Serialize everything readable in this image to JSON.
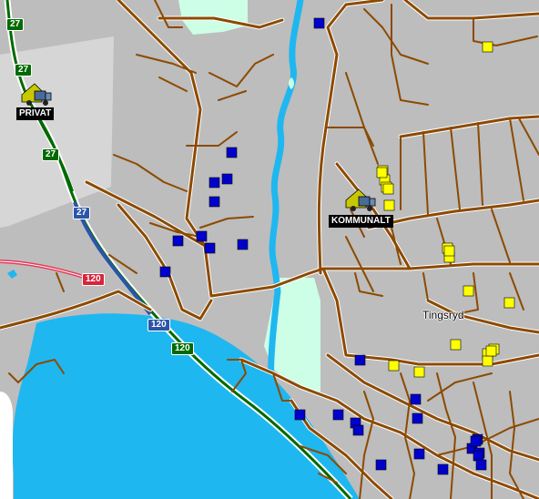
{
  "colors": {
    "background": "#bdbdbd",
    "urban_light": "#d4d4d4",
    "water": "#1fb7f0",
    "park": "#ccffe6",
    "road": "#8c4a00",
    "road_casing": "#ffffff",
    "highway": "#006a00",
    "highway_alt": "#2b55a8",
    "rail": "#e83a5a",
    "marker_blue": "#0000cc",
    "marker_yellow": "#ffff00"
  },
  "depots": [
    {
      "name": "privat-depot",
      "label": "PRIVAT"
    },
    {
      "name": "kommunalt-depot",
      "label": "KOMMUNALT"
    }
  ],
  "place_labels": [
    {
      "name": "tingsryd-label",
      "text": "Tingsryd"
    }
  ],
  "road_shields": [
    {
      "name": "shield-27",
      "text": "27",
      "color": "#006a00"
    },
    {
      "name": "shield-27",
      "text": "27",
      "color": "#006a00"
    },
    {
      "name": "shield-27",
      "text": "27",
      "color": "#006a00"
    },
    {
      "name": "shield-27",
      "text": "27",
      "color": "#2b55a8"
    },
    {
      "name": "shield-120",
      "text": "120",
      "color": "#d8243c"
    },
    {
      "name": "shield-120",
      "text": "120",
      "color": "#2b55a8"
    },
    {
      "name": "shield-120",
      "text": "120",
      "color": "#006a00"
    }
  ],
  "markers": {
    "blue_count": 26,
    "yellow_count": 20
  }
}
